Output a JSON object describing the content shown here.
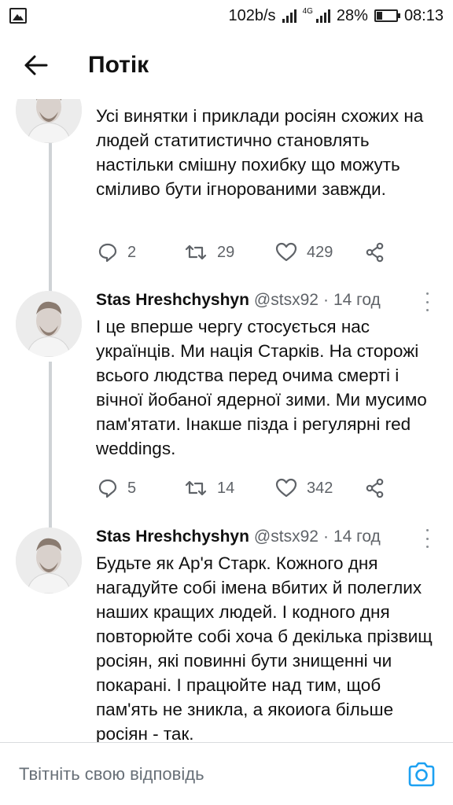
{
  "status_bar": {
    "speed": "102b/s",
    "network_label": "4G",
    "battery_percent": "28%",
    "battery_level": 0.28,
    "time": "08:13"
  },
  "header": {
    "title": "Потік",
    "back_icon": "arrow-left-icon"
  },
  "tweets": [
    {
      "text": "Усі винятки і приклади росіян схожих на людей статитистично становлять настільки смішну похибку що можуть сміливо бути ігнорованими завжди.",
      "replies": "2",
      "retweets": "29",
      "likes": "429"
    },
    {
      "author": "Stas Hreshchyshyn",
      "handle": "@stsx92",
      "separator": "·",
      "time": "14 год",
      "text": "І це вперше чергу стосується нас українців. Ми нація Старків. На сторожі всього людства перед очима смерті і вічної йобаної ядерної зими. Ми мусимо пам'ятати. Інакше пізда і регулярні red weddings.",
      "replies": "5",
      "retweets": "14",
      "likes": "342"
    },
    {
      "author": "Stas Hreshchyshyn",
      "handle": "@stsx92",
      "separator": "·",
      "time": "14 год",
      "text": "Будьте як Ар'я Старк. Кожного дня нагадуйте собі імена вбитих й полеглих наших кращих людей. І кодного дня повторюйте собі хоча б декілька прізвищ росіян, які повинні бути знищенні чи покарані. І працюйте над тим, щоб пам'ять не зникла, а якоиога більше росіян - так."
    }
  ],
  "reply_bar": {
    "placeholder": "Твітніть свою відповідь",
    "camera_icon": "camera-icon"
  },
  "colors": {
    "accent": "#1da1f2",
    "muted_text": "#5f6368",
    "thread_line": "#cfd3d6"
  }
}
